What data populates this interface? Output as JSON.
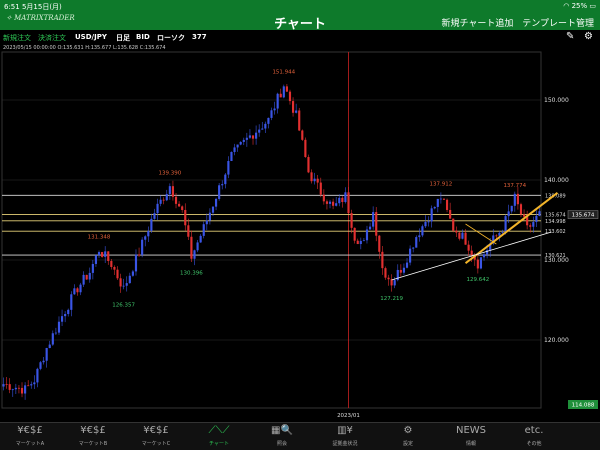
{
  "status": {
    "time": "6:51",
    "date": "5月15日(月)",
    "battery": "25%"
  },
  "header": {
    "logo": "MATRIXTRADER",
    "title": "チャート",
    "add_chart": "新規チャート追加",
    "template": "テンプレート管理"
  },
  "toolbar": {
    "new_order": "新規注文",
    "settle_order": "決済注文",
    "pair": "USD/JPY",
    "timeframe": "日足",
    "price_type": "BID",
    "chart_type": "ローソク",
    "count": "377"
  },
  "info_line": "2023/05/15 00:00:00   O:135.631  H:135.677  L:135.628  C:135.674",
  "chart_data": {
    "type": "candlestick",
    "ylim": [
      111.5,
      156
    ],
    "yticks": [
      120.0,
      130.0,
      140.0,
      150.0
    ],
    "ytick_labels": [
      "120.000",
      "130.000",
      "140.000",
      "150.000"
    ],
    "x_marker_label": "2023/01",
    "last_price": "135.674",
    "bottom_price": "114.088",
    "hlines": [
      {
        "value": 138.089,
        "label": "138.089",
        "color": "#dddddd"
      },
      {
        "value": 135.674,
        "label": "135.674",
        "color": "#e8d27a"
      },
      {
        "value": 134.9,
        "label": "134.998",
        "color": "#e8d27a"
      },
      {
        "value": 133.602,
        "label": "133.602",
        "color": "#e8d27a"
      },
      {
        "value": 130.621,
        "label": "130.621",
        "color": "#dddddd"
      }
    ],
    "peak_labels": [
      {
        "text": "151.944",
        "color": "#e0603a"
      },
      {
        "text": "139.390",
        "color": "#e0603a"
      },
      {
        "text": "131.348",
        "color": "#e0603a"
      },
      {
        "text": "137.912",
        "color": "#e0603a"
      },
      {
        "text": "137.774",
        "color": "#e0603a"
      }
    ],
    "trough_labels": [
      {
        "text": "126.357",
        "color": "#3fc46a"
      },
      {
        "text": "130.396",
        "color": "#3fc46a"
      },
      {
        "text": "127.219",
        "color": "#3fc46a"
      },
      {
        "text": "129.642",
        "color": "#3fc46a"
      }
    ],
    "anchors": [
      [
        0,
        114.5
      ],
      [
        7,
        113.8
      ],
      [
        10,
        115
      ],
      [
        14,
        119
      ],
      [
        19,
        123
      ],
      [
        24,
        126.5
      ],
      [
        28,
        128.5
      ],
      [
        31,
        131.3
      ],
      [
        35,
        129.5
      ],
      [
        39,
        126.4
      ],
      [
        44,
        131
      ],
      [
        49,
        136
      ],
      [
        54,
        139.3
      ],
      [
        58,
        136
      ],
      [
        61,
        130.4
      ],
      [
        65,
        134
      ],
      [
        69,
        138
      ],
      [
        74,
        143
      ],
      [
        80,
        145.5
      ],
      [
        86,
        147.5
      ],
      [
        91,
        151.9
      ],
      [
        95,
        148
      ],
      [
        99,
        141
      ],
      [
        103,
        138.5
      ],
      [
        107,
        136.5
      ],
      [
        111,
        138
      ],
      [
        114,
        133
      ],
      [
        117,
        132
      ],
      [
        120,
        136
      ],
      [
        123,
        129
      ],
      [
        126,
        127.2
      ],
      [
        130,
        129.5
      ],
      [
        134,
        133
      ],
      [
        138,
        135.5
      ],
      [
        142,
        137.9
      ],
      [
        146,
        134
      ],
      [
        150,
        132.5
      ],
      [
        154,
        129.6
      ],
      [
        158,
        132
      ],
      [
        162,
        134
      ],
      [
        166,
        137.7
      ],
      [
        170,
        133.8
      ],
      [
        174,
        135.7
      ]
    ],
    "candle_count": 175,
    "candle_up": "#3a55e6",
    "candle_down": "#e23030",
    "colors": {
      "background": "#000000",
      "grid": "#333333",
      "vertical_marker": "#cc2222",
      "trendline_yellow": "#f2b42a",
      "trendline_white": "#ffffff",
      "price_box": "#1f8f3a"
    }
  },
  "tabs": [
    {
      "icon": "¥€$£",
      "label": "マーケットA"
    },
    {
      "icon": "¥€$£",
      "label": "マーケットB"
    },
    {
      "icon": "¥€$£",
      "label": "マーケットC"
    },
    {
      "icon": "⟋⟍⟋",
      "label": "チャート"
    },
    {
      "icon": "▦🔍",
      "label": "照会"
    },
    {
      "icon": "▥¥",
      "label": "証拠金状況"
    },
    {
      "icon": "⚙",
      "label": "設定"
    },
    {
      "icon": "NEWS",
      "label": "情報"
    },
    {
      "icon": "etc.",
      "label": "その他"
    }
  ],
  "active_tab": 3
}
